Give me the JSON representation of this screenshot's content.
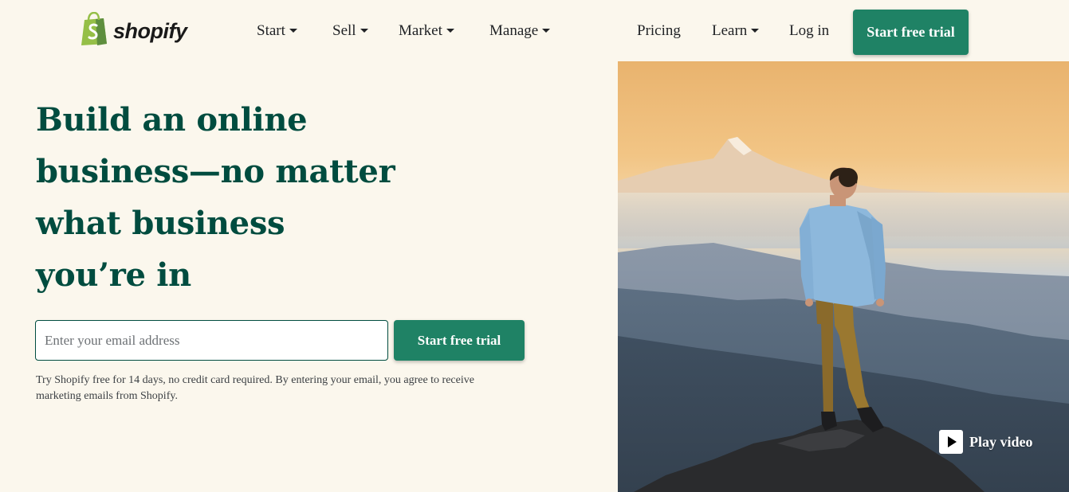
{
  "brand": {
    "name": "shopify",
    "accent": "#1f8265",
    "heading_color": "#004c3f",
    "background": "#fbf7ed",
    "logo_icon": "shopping-bag-icon"
  },
  "nav": {
    "items": [
      {
        "label": "Start",
        "dropdown": true
      },
      {
        "label": "Sell",
        "dropdown": true
      },
      {
        "label": "Market",
        "dropdown": true
      },
      {
        "label": "Manage",
        "dropdown": true
      }
    ],
    "right": [
      {
        "label": "Pricing",
        "dropdown": false
      },
      {
        "label": "Learn",
        "dropdown": true
      },
      {
        "label": "Log in",
        "dropdown": false
      }
    ],
    "cta_label": "Start free trial"
  },
  "hero": {
    "title": "Build an online business—no matter what business you’re in",
    "email_placeholder": "Enter your email address",
    "email_value": "",
    "cta_label": "Start free trial",
    "disclaimer": "Try Shopify free for 14 days, no credit card required. By entering your email, you agree to receive marketing emails from Shopify.",
    "video_label": "Play video",
    "video_icon": "play-icon"
  }
}
